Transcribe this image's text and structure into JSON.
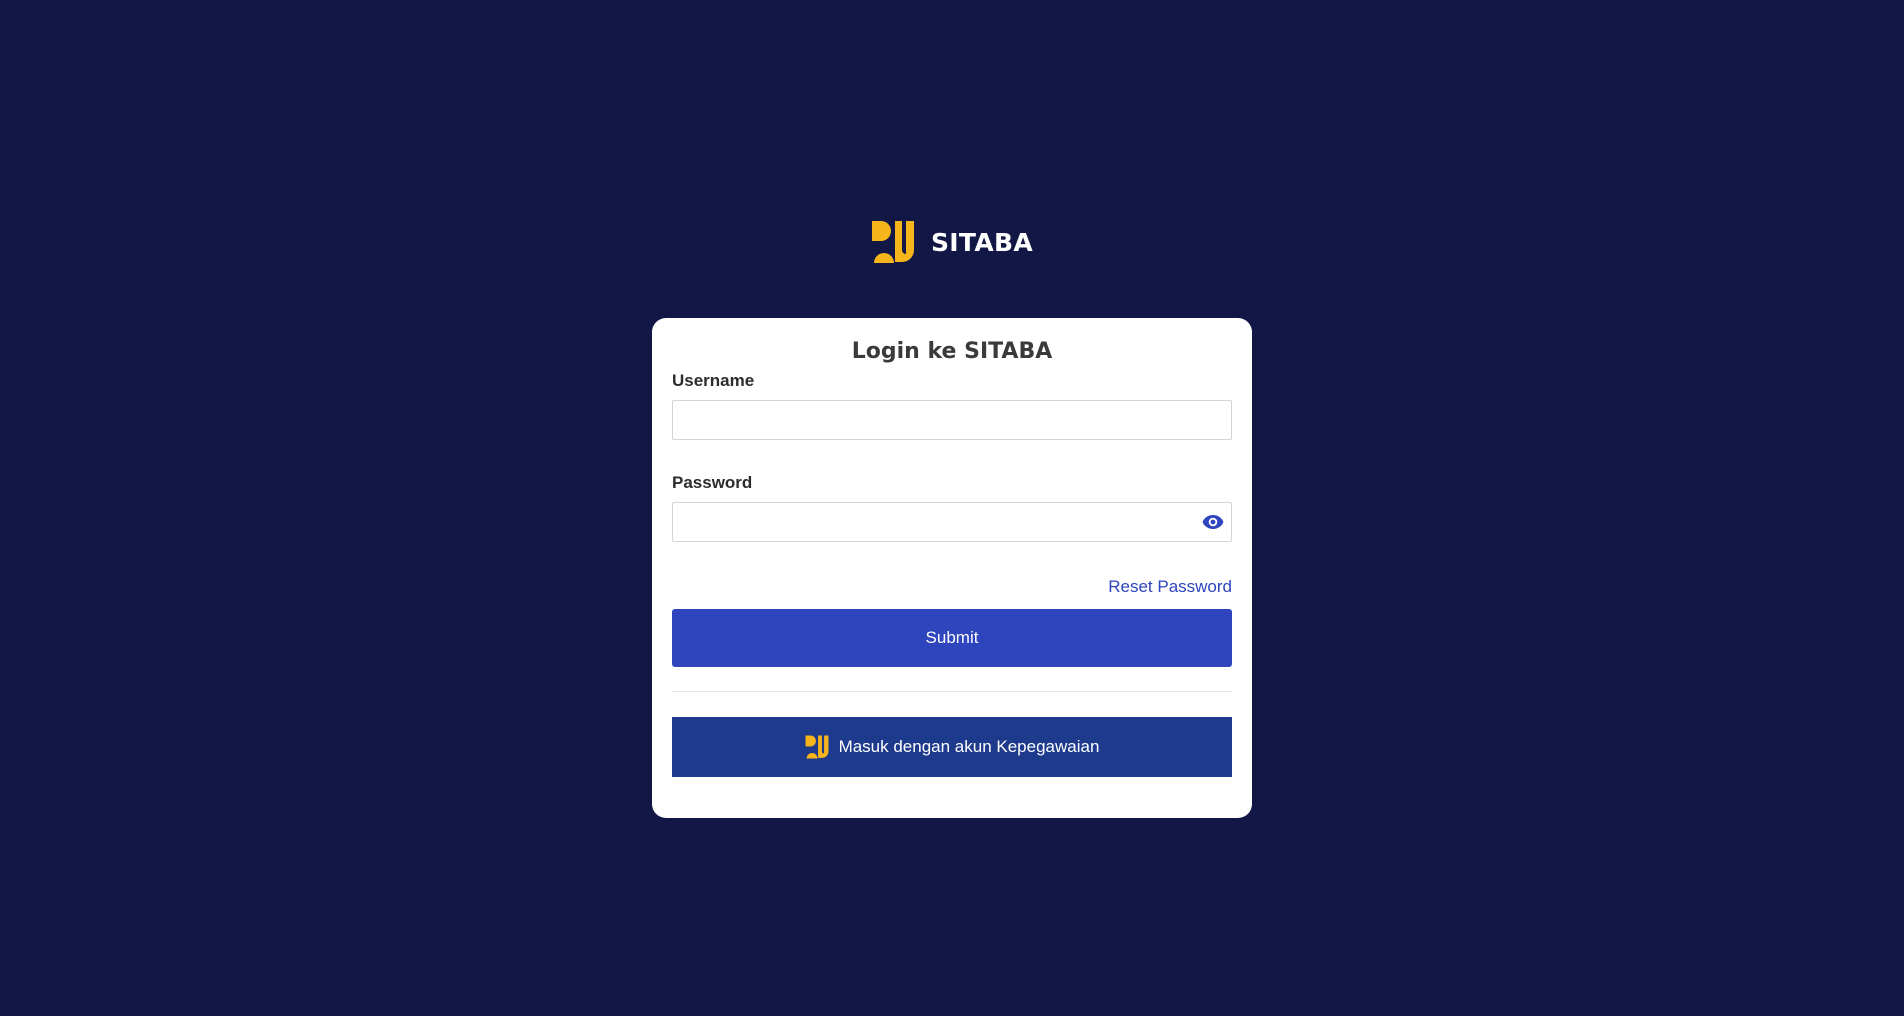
{
  "app": {
    "name": "SITABA",
    "logo_icon": "pu-logo-icon"
  },
  "login": {
    "title": "Login ke SITABA",
    "username_label": "Username",
    "username_value": "",
    "password_label": "Password",
    "password_value": "",
    "password_toggle_icon": "eye-icon",
    "reset_password_label": "Reset Password",
    "submit_label": "Submit",
    "sso_label": "Masuk dengan akun Kepegawaian",
    "sso_icon": "pu-logo-icon"
  },
  "colors": {
    "background": "#121745",
    "card": "#ffffff",
    "primary": "#2e45bd",
    "sso_button": "#1e3a8c",
    "logo_yellow": "#f6b51a",
    "text_dark": "#2d2d2d"
  }
}
